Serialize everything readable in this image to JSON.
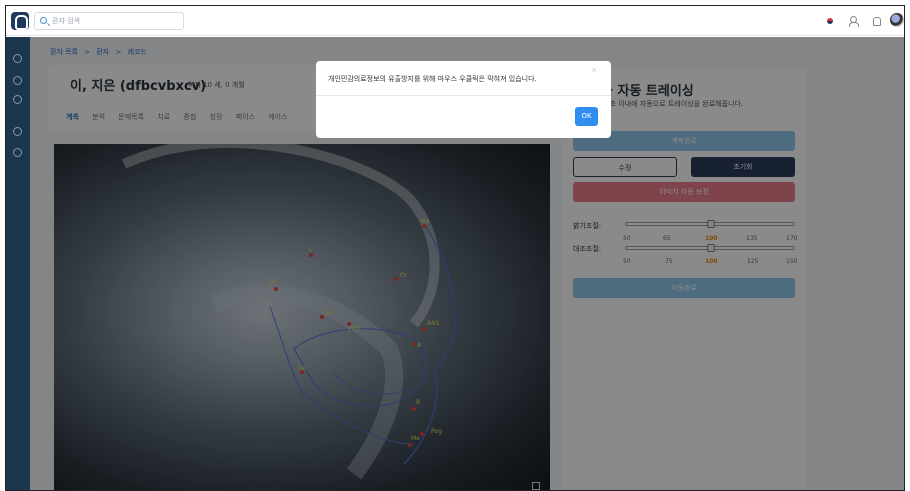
{
  "header": {
    "search_placeholder": "환자 검색",
    "icons": [
      "korean-flag-icon",
      "users-icon",
      "bell-icon",
      "globe-icon"
    ]
  },
  "breadcrumb": {
    "items": [
      "환자 목록",
      "환자",
      "레코드"
    ],
    "separators": [
      ">",
      ">"
    ]
  },
  "patient": {
    "name": "이, 지은 (dfbcvbxcv)",
    "meta": "여자 10 세, 0 개월"
  },
  "tabs": [
    {
      "label": "계측",
      "active": true
    },
    {
      "label": "분석"
    },
    {
      "label": "문제목록"
    },
    {
      "label": "치료"
    },
    {
      "label": "중첩"
    },
    {
      "label": "성장"
    },
    {
      "label": "페이스"
    },
    {
      "label": "케이스"
    }
  ],
  "landmarks": [
    "Na",
    "S",
    "Or",
    "Po",
    "R3",
    "ANS",
    "PNS",
    "A",
    "Go",
    "B",
    "Pog",
    "Me"
  ],
  "tracing_panel": {
    "title": "능 자동 트레이싱",
    "subtitle": "수 초 이내에 자동으로 트레이싱을 완료해줍니다.",
    "measure_button": "계측완료",
    "edit_button": "수정",
    "reset_button": "초기화",
    "enhance_button": "이미지 자동 보정",
    "brightness_label": "밝기조절:",
    "contrast_label": "대조조절:",
    "brightness_ticks": [
      "50",
      "65",
      "100",
      "135",
      "170"
    ],
    "contrast_ticks": [
      "50",
      "75",
      "100",
      "125",
      "150"
    ],
    "brightness_value": 100,
    "contrast_value": 100,
    "enhance_done_button": "자동완료"
  },
  "dialog": {
    "message": "개인민감의료정보의 유출방지를 위해 마우스 우클릭은 막혀져 있습니다.",
    "close": "×",
    "ok_label": "OK"
  },
  "colors": {
    "sidebar": "#1d3650",
    "accent": "#2f8ef0",
    "measure_button": "#8ec7ea",
    "dark_button": "#2c3e5b",
    "enhance_button": "#eb7c8b",
    "active_tick": "#e08a00"
  }
}
